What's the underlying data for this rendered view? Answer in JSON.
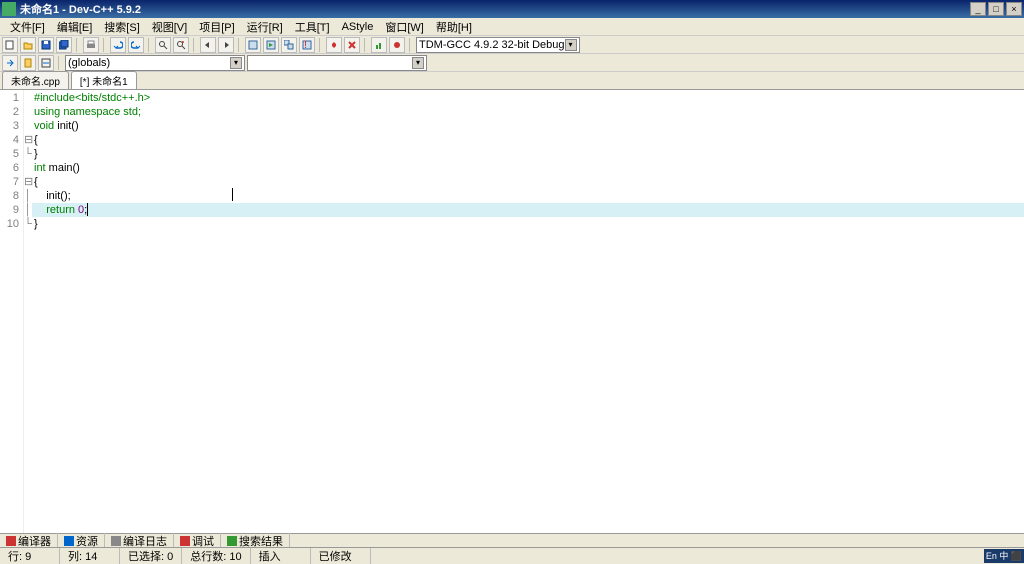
{
  "title": "未命名1 - Dev-C++ 5.9.2",
  "menus": [
    "文件[F]",
    "编辑[E]",
    "搜索[S]",
    "视图[V]",
    "项目[P]",
    "运行[R]",
    "工具[T]",
    "AStyle",
    "窗口[W]",
    "帮助[H]"
  ],
  "combo1": "(globals)",
  "combo2": "",
  "compiler_combo": "TDM-GCC 4.9.2 32-bit Debug",
  "tabs": [
    {
      "label": "未命名.cpp",
      "active": false
    },
    {
      "label": "[*] 未命名1",
      "active": true
    }
  ],
  "code_lines": [
    {
      "n": 1,
      "fold": "",
      "segs": [
        {
          "t": "#include<bits/stdc++.h>",
          "c": "kw-green"
        }
      ]
    },
    {
      "n": 2,
      "fold": "",
      "segs": [
        {
          "t": "using namespace std;",
          "c": "kw-green"
        }
      ]
    },
    {
      "n": 3,
      "fold": "",
      "segs": [
        {
          "t": "void",
          "c": "kw-green"
        },
        {
          "t": " init()",
          "c": ""
        }
      ]
    },
    {
      "n": 4,
      "fold": "⊟",
      "segs": [
        {
          "t": "{",
          "c": ""
        }
      ]
    },
    {
      "n": 5,
      "fold": "└",
      "segs": [
        {
          "t": "}",
          "c": ""
        }
      ]
    },
    {
      "n": 6,
      "fold": "",
      "segs": [
        {
          "t": "int",
          "c": "kw-green"
        },
        {
          "t": " main()",
          "c": ""
        }
      ]
    },
    {
      "n": 7,
      "fold": "⊟",
      "segs": [
        {
          "t": "{",
          "c": ""
        }
      ]
    },
    {
      "n": 8,
      "fold": "│",
      "segs": [
        {
          "t": "    init();",
          "c": ""
        }
      ]
    },
    {
      "n": 9,
      "fold": "│",
      "hl": true,
      "segs": [
        {
          "t": "    ",
          "c": ""
        },
        {
          "t": "return",
          "c": "kw-green"
        },
        {
          "t": " ",
          "c": ""
        },
        {
          "t": "0",
          "c": "kw-num"
        },
        {
          "t": ";",
          "c": ""
        }
      ],
      "caret": true
    },
    {
      "n": 10,
      "fold": "└",
      "segs": [
        {
          "t": "}",
          "c": ""
        }
      ]
    }
  ],
  "bottom_tabs": [
    "编译器",
    "资源",
    "编译日志",
    "调试",
    "搜索结果"
  ],
  "status": {
    "line_col_label": "行:",
    "line": "9",
    "col_label": "列:",
    "col": "14",
    "sel_label": "已选择:",
    "sel": "0",
    "total_label": "总行数:",
    "total": "10",
    "ins": "插入",
    "mod": "已修改"
  },
  "ime": "En 中 ⬛"
}
